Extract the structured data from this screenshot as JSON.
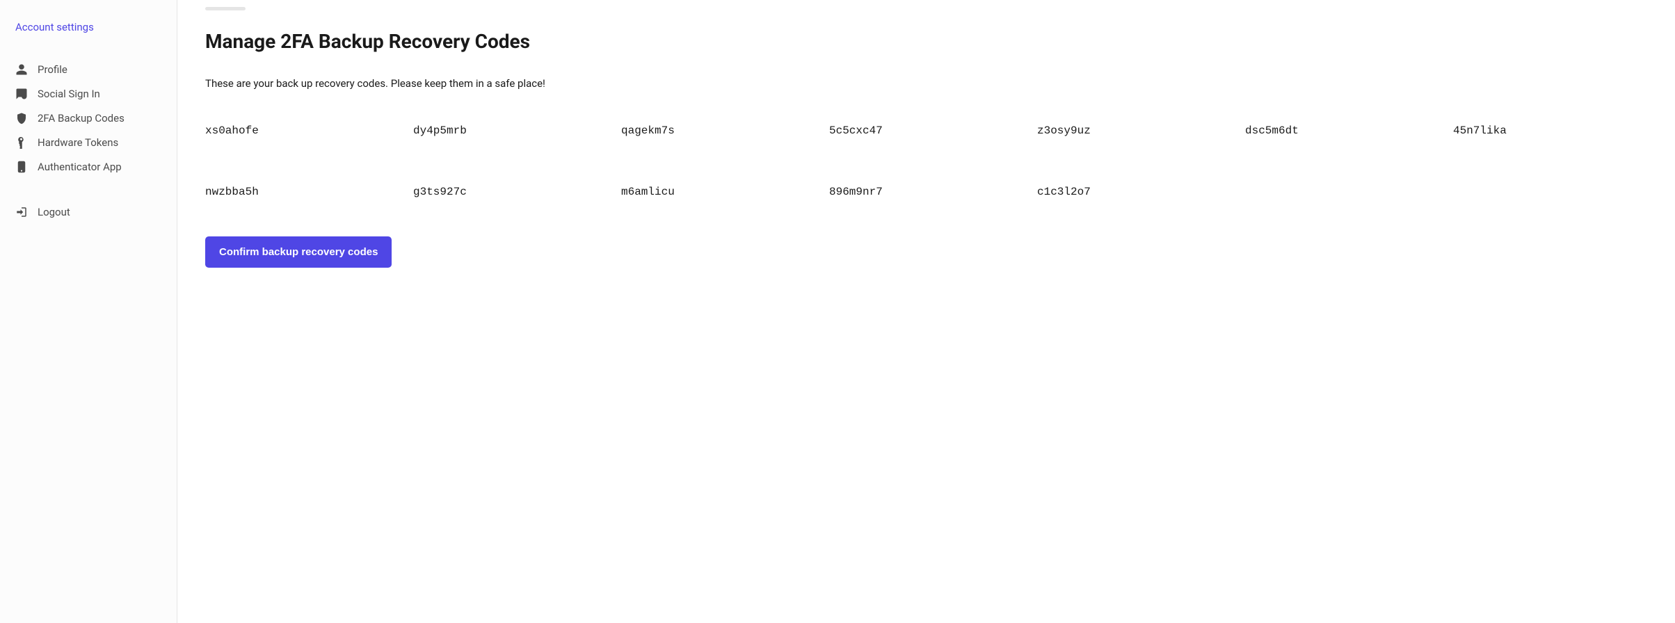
{
  "sidebar": {
    "title": "Account settings",
    "items": [
      {
        "label": "Profile"
      },
      {
        "label": "Social Sign In"
      },
      {
        "label": "2FA Backup Codes"
      },
      {
        "label": "Hardware Tokens"
      },
      {
        "label": "Authenticator App"
      }
    ],
    "logout_label": "Logout"
  },
  "main": {
    "title": "Manage 2FA Backup Recovery Codes",
    "description": "These are your back up recovery codes. Please keep them in a safe place!",
    "codes": [
      "xs0ahofe",
      "dy4p5mrb",
      "qagekm7s",
      "5c5cxc47",
      "z3osy9uz",
      "dsc5m6dt",
      "45n7lika",
      "nwzbba5h",
      "g3ts927c",
      "m6amlicu",
      "896m9nr7",
      "c1c3l2o7"
    ],
    "confirm_label": "Confirm backup recovery codes"
  }
}
